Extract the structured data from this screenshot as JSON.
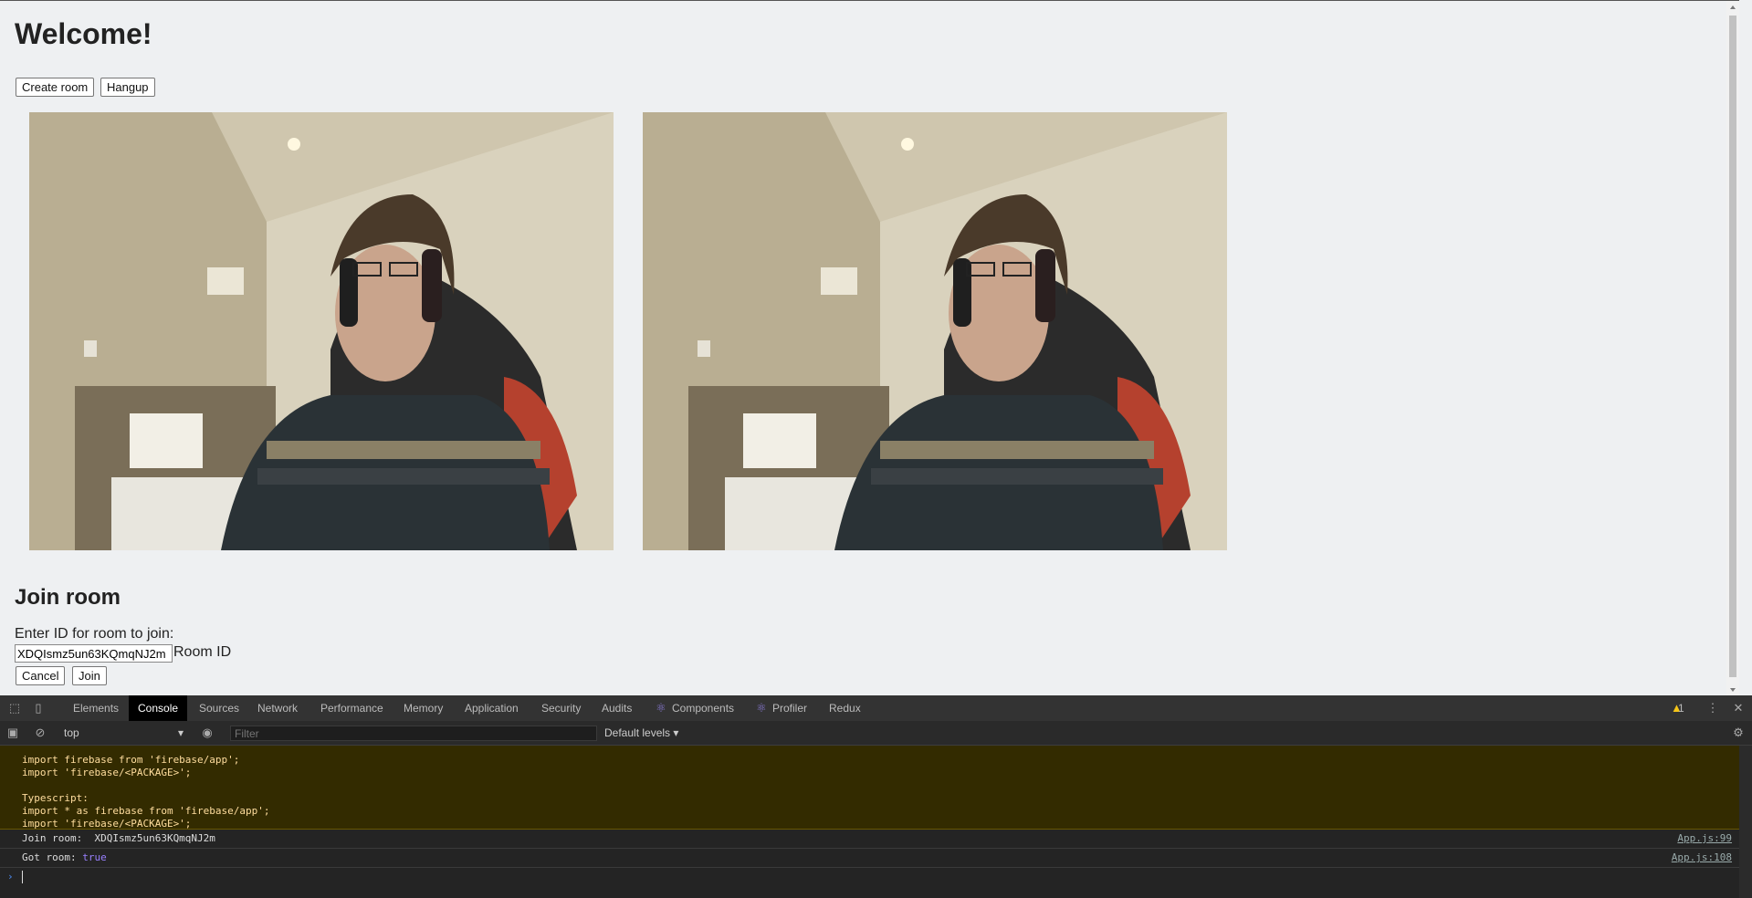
{
  "page": {
    "title": "Welcome!",
    "create_room": "Create room",
    "hangup": "Hangup",
    "join_title": "Join room",
    "join_prompt": "Enter ID for room to join:",
    "room_id_value": "XDQIsmz5un63KQmqNJ2m",
    "room_id_label": "Room ID",
    "cancel": "Cancel",
    "join": "Join"
  },
  "videos": [
    {
      "name": "local-video"
    },
    {
      "name": "remote-video"
    }
  ],
  "devtools": {
    "tabs": [
      "Elements",
      "Console",
      "Sources",
      "Network",
      "Performance",
      "Memory",
      "Application",
      "Security",
      "Audits",
      "Components",
      "Profiler",
      "Redux"
    ],
    "active_tab": "Console",
    "warning_count": "1",
    "context": "top",
    "filter_placeholder": "Filter",
    "levels": "Default levels",
    "warning_lines": [
      "import firebase from 'firebase/app';",
      "import 'firebase/<PACKAGE>';",
      "",
      "Typescript:",
      "import * as firebase from 'firebase/app';",
      "import 'firebase/<PACKAGE>';"
    ],
    "logs": [
      {
        "message": "Join room:  XDQIsmz5un63KQmqNJ2m",
        "source": "App.js:99"
      },
      {
        "message": "Got room: ",
        "value": "true",
        "source": "App.js:108"
      }
    ]
  },
  "colors": {
    "page_bg": "#eef0f2",
    "devtools_bg": "#242424",
    "warning_bg": "#332b00",
    "warning_text": "#ffdd9e"
  }
}
